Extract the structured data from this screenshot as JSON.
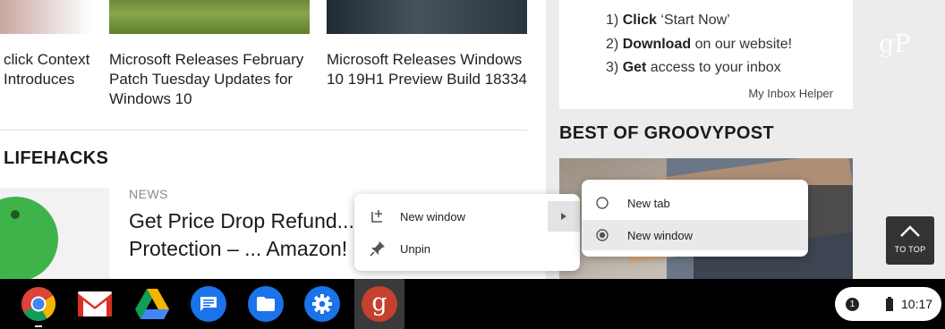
{
  "articles": {
    "col1_text": "click Context\nIntroduces",
    "col2_title": "Microsoft Releases February Patch Tuesday Updates for Windows 10",
    "col3_title": "Microsoft Releases Windows 10 19H1 Preview Build 18334"
  },
  "section_heading": "LIFEHACKS",
  "news": {
    "category": "NEWS",
    "title": "Get Price Drop Refund... Card Price Protection – ... Amazon!"
  },
  "ad": {
    "step1_num": "1)",
    "step1_bold": "Click",
    "step1_rest": " ‘Start Now’",
    "step2_num": "2)",
    "step2_bold": "Download",
    "step2_rest": " on our website!",
    "step3_num": "3)",
    "step3_bold": "Get",
    "step3_rest": " access to your inbox",
    "footer": "My Inbox Helper"
  },
  "best_heading": "BEST OF GROOVYPOST",
  "logo_text": "gP",
  "to_top_label": "TO TOP",
  "context_menu": {
    "items": [
      "New window",
      "Unpin"
    ],
    "submenu": {
      "items": [
        "New tab",
        "New window"
      ],
      "selected": "New window"
    }
  },
  "shelf": {
    "apps": [
      "chrome-icon",
      "gmail-icon",
      "drive-icon",
      "messages-icon",
      "files-icon",
      "settings-icon",
      "groovypost-icon"
    ],
    "time": "10:17",
    "notification_count": "1"
  }
}
